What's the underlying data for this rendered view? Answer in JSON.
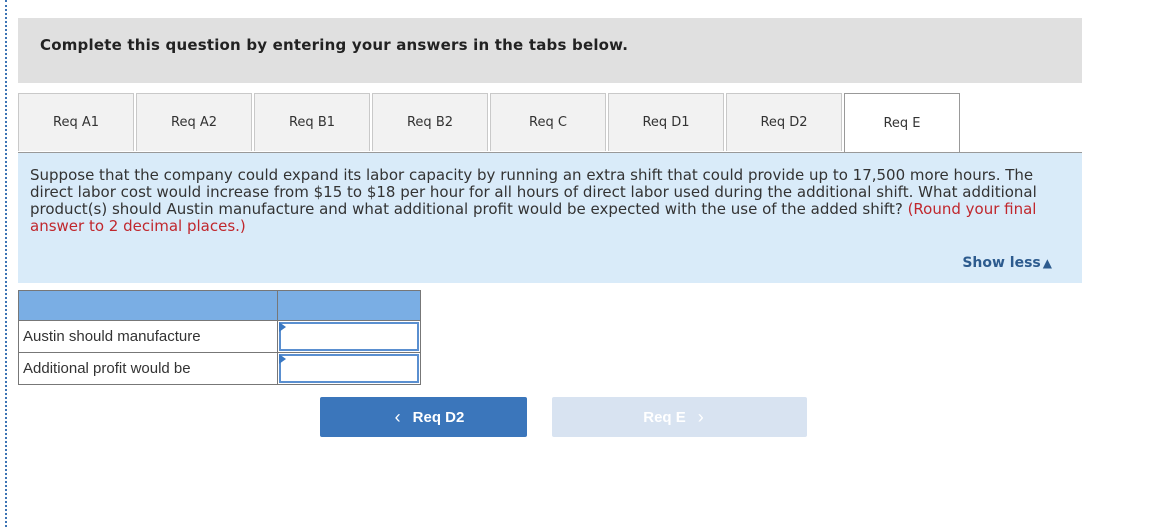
{
  "header": {
    "title": "Complete this question by entering your answers in the tabs below."
  },
  "tabs": [
    {
      "label": "Req A1",
      "active": false
    },
    {
      "label": "Req A2",
      "active": false
    },
    {
      "label": "Req B1",
      "active": false
    },
    {
      "label": "Req B2",
      "active": false
    },
    {
      "label": "Req C",
      "active": false
    },
    {
      "label": "Req D1",
      "active": false
    },
    {
      "label": "Req D2",
      "active": false
    },
    {
      "label": "Req E",
      "active": true
    }
  ],
  "question": {
    "text": "Suppose that the company could expand its labor capacity by running an extra shift that could provide up to 17,500 more hours. The direct labor cost would increase from $15 to $18 per hour for all hours of direct labor used during the additional shift. What additional product(s) should Austin manufacture and what additional profit would be expected with the use of the added shift? ",
    "hint": "(Round your final answer to 2 decimal places.)",
    "show_less": "Show less",
    "show_less_icon": "triangle-up-icon"
  },
  "answer_table": {
    "rows": [
      {
        "label": "Austin should manufacture",
        "value": ""
      },
      {
        "label": "Additional profit would be",
        "value": ""
      }
    ]
  },
  "nav": {
    "prev_label": "Req D2",
    "next_label": "Req E",
    "prev_icon": "chevron-left-icon",
    "next_icon": "chevron-right-icon"
  }
}
